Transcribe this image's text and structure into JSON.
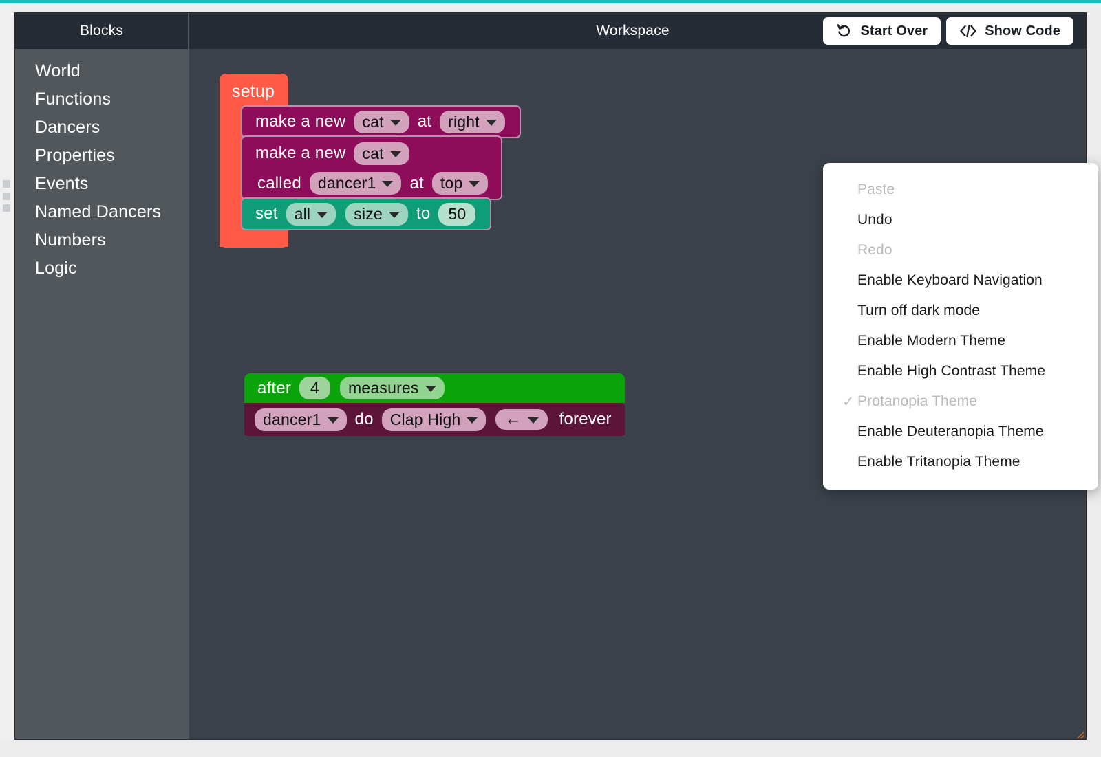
{
  "header": {
    "blocks_title": "Blocks",
    "workspace_title": "Workspace",
    "start_over_label": "Start Over",
    "show_code_label": "Show Code"
  },
  "sidebar": {
    "items": [
      {
        "label": "World"
      },
      {
        "label": "Functions"
      },
      {
        "label": "Dancers"
      },
      {
        "label": "Properties"
      },
      {
        "label": "Events"
      },
      {
        "label": "Named Dancers"
      },
      {
        "label": "Numbers"
      },
      {
        "label": "Logic"
      }
    ]
  },
  "workspace": {
    "setup_script": {
      "hat_label": "setup",
      "rows": [
        {
          "kind": "make_a_new_at",
          "text_1": "make a new",
          "dancer_type": "cat",
          "text_2": "at",
          "location": "right"
        },
        {
          "kind": "make_a_new_called_at",
          "text_1": "make a new",
          "dancer_type": "cat",
          "text_2": "called",
          "dancer_name": "dancer1",
          "text_3": "at",
          "location": "top"
        },
        {
          "kind": "set_property",
          "text_1": "set",
          "target": "all",
          "property": "size",
          "text_2": "to",
          "value": "50"
        }
      ]
    },
    "event_script": {
      "after_text": "after",
      "after_count": "4",
      "after_unit": "measures",
      "dancer": "dancer1",
      "do_text": "do",
      "move": "Clap High",
      "direction_icon": "←",
      "forever_text": "forever"
    }
  },
  "context_menu": {
    "items": [
      {
        "label": "Paste",
        "disabled": true,
        "checked": false
      },
      {
        "label": "Undo",
        "disabled": false,
        "checked": false
      },
      {
        "label": "Redo",
        "disabled": true,
        "checked": false
      },
      {
        "label": "Enable Keyboard Navigation",
        "disabled": false,
        "checked": false
      },
      {
        "label": "Turn off dark mode",
        "disabled": false,
        "checked": false
      },
      {
        "label": "Enable Modern Theme",
        "disabled": false,
        "checked": false
      },
      {
        "label": "Enable High Contrast Theme",
        "disabled": false,
        "checked": false
      },
      {
        "label": "Protanopia Theme",
        "disabled": true,
        "checked": true
      },
      {
        "label": "Enable Deuteranopia Theme",
        "disabled": false,
        "checked": false
      },
      {
        "label": "Enable Tritanopia Theme",
        "disabled": false,
        "checked": false
      }
    ],
    "check_glyph": "✓"
  },
  "colors": {
    "accent_top": "#2bb8c4",
    "header_bg": "#262c35",
    "sidebar_bg": "#52575c",
    "workspace_bg": "#3c424b",
    "block_event": "#ff5a45",
    "block_dancer": "#8e0d5a",
    "block_property": "#0f9d77",
    "block_control": "#0aa30a",
    "block_action": "#5c1438"
  }
}
